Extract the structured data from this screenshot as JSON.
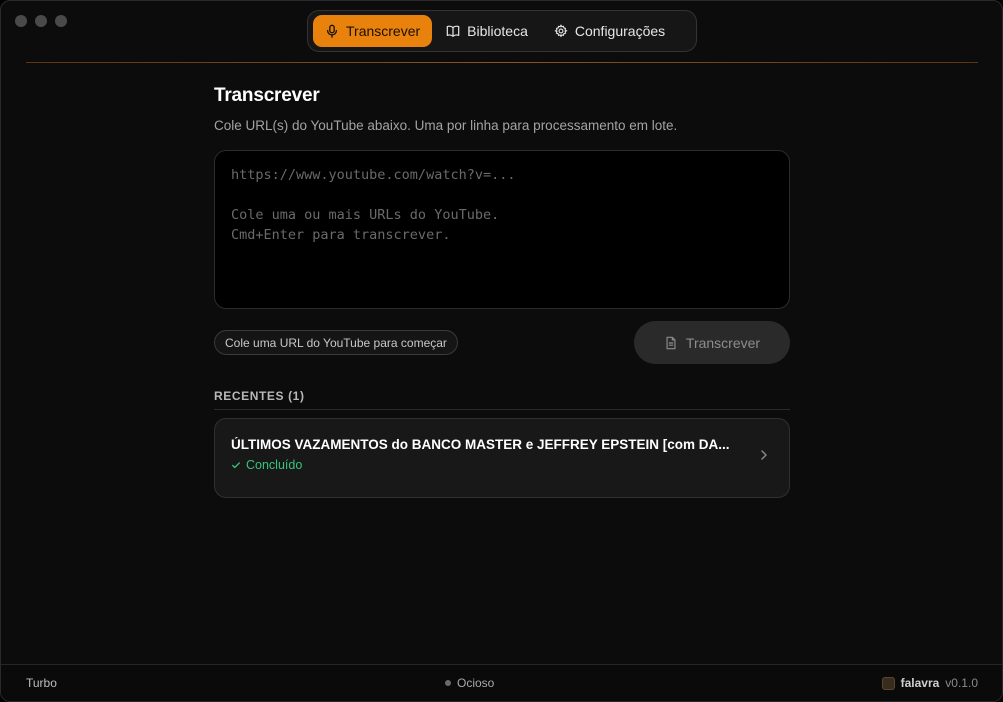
{
  "nav": {
    "items": [
      {
        "label": "Transcrever",
        "icon": "microphone-icon",
        "active": true
      },
      {
        "label": "Biblioteca",
        "icon": "book-icon",
        "active": false
      },
      {
        "label": "Configurações",
        "icon": "gear-icon",
        "active": false
      }
    ]
  },
  "main": {
    "title": "Transcrever",
    "subtitle": "Cole URL(s) do YouTube abaixo. Uma por linha para processamento em lote.",
    "input": {
      "value": "",
      "placeholder": "https://www.youtube.com/watch?v=...\n\nCole uma ou mais URLs do YouTube.\nCmd+Enter para transcrever."
    },
    "hint": "Cole uma URL do YouTube para começar",
    "transcribe_button": "Transcrever"
  },
  "recent": {
    "header": "RECENTES (1)",
    "items": [
      {
        "title": "ÚLTIMOS VAZAMENTOS do BANCO MASTER e JEFFREY EPSTEIN [com DA...",
        "status": "Concluído"
      }
    ]
  },
  "footer": {
    "mode": "Turbo",
    "status": "Ocioso",
    "app_name": "falavra",
    "version": "v0.1.0"
  },
  "colors": {
    "accent": "#e8820c",
    "success": "#36c47a",
    "background": "#0c0c0c"
  }
}
